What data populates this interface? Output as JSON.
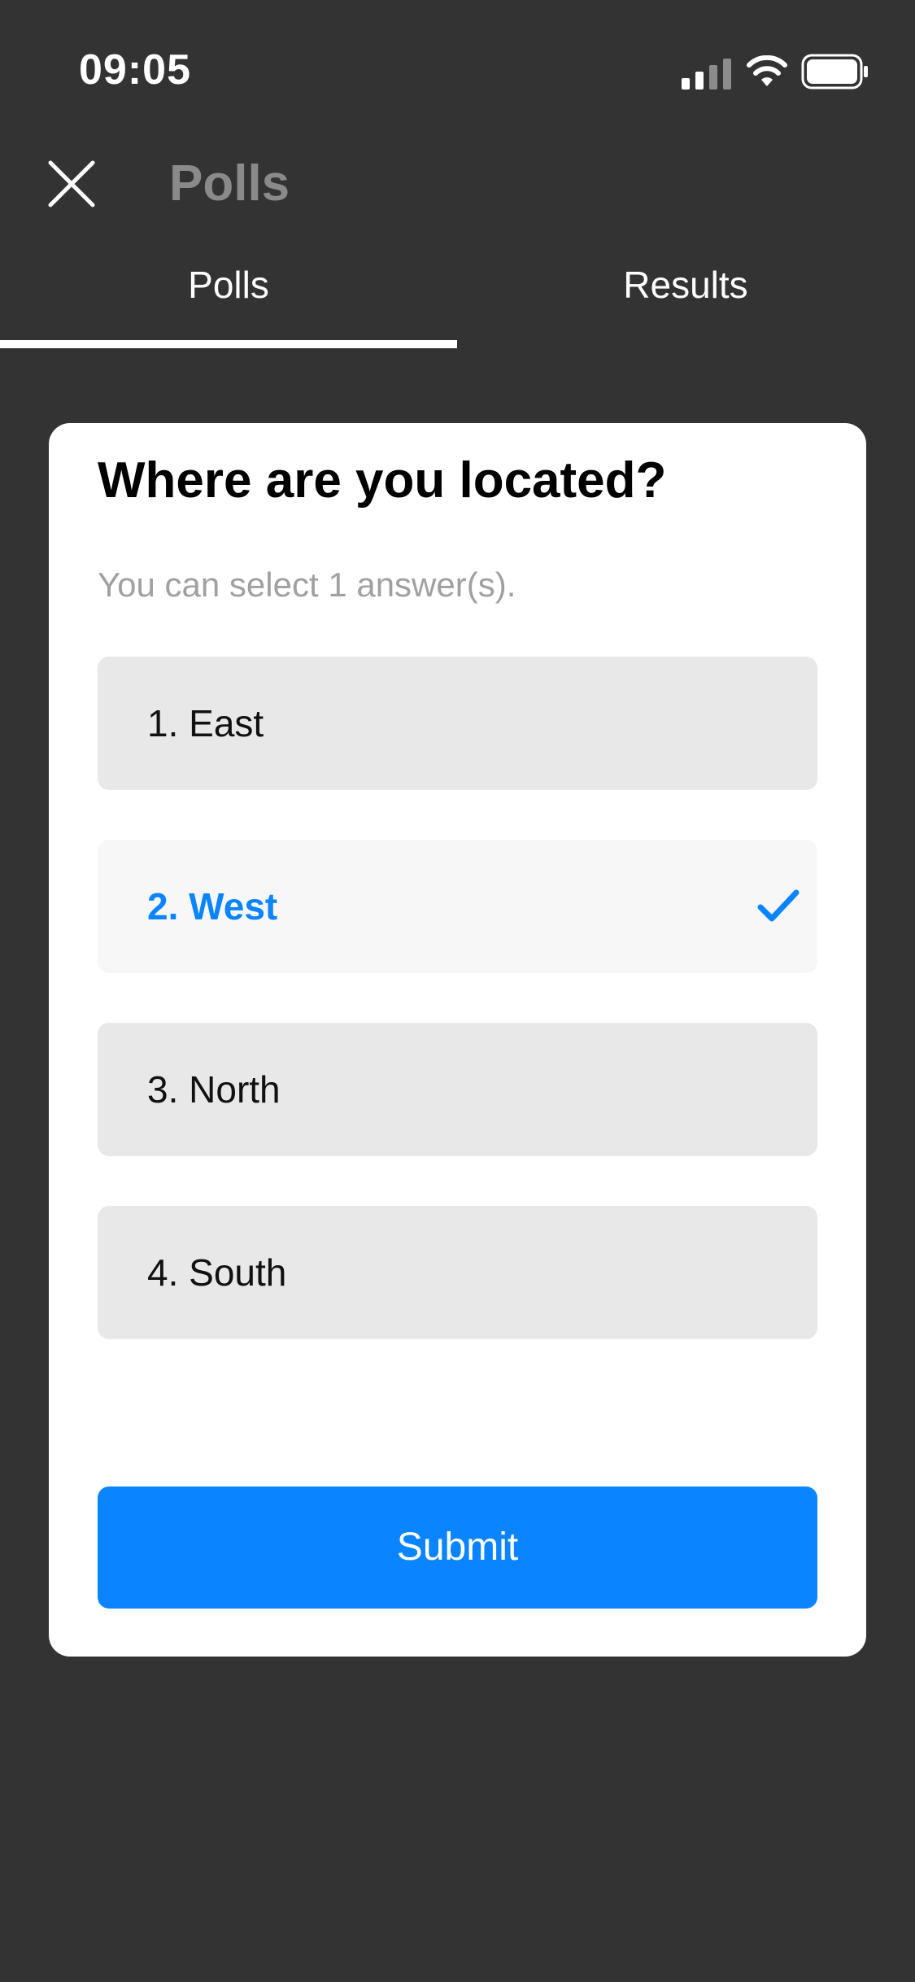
{
  "status_bar": {
    "time": "09:05",
    "icons": [
      "signal-icon",
      "wifi-icon",
      "battery-icon"
    ]
  },
  "header": {
    "close_icon": "close-icon",
    "title": "Polls"
  },
  "tabs": [
    {
      "label": "Polls",
      "active": true
    },
    {
      "label": "Results",
      "active": false
    }
  ],
  "poll": {
    "question": "Where are you located?",
    "hint": "You can select 1 answer(s).",
    "options": [
      {
        "label": "1. East",
        "selected": false
      },
      {
        "label": "2. West",
        "selected": true
      },
      {
        "label": "3. North",
        "selected": false
      },
      {
        "label": "4. South",
        "selected": false
      }
    ],
    "submit_label": "Submit"
  },
  "colors": {
    "background": "#333333",
    "accent": "#0a84ff",
    "card": "#ffffff",
    "option_bg": "#e8e8e8",
    "selected_option_bg": "#f7f7f7",
    "header_title": "#8a8a8a"
  }
}
